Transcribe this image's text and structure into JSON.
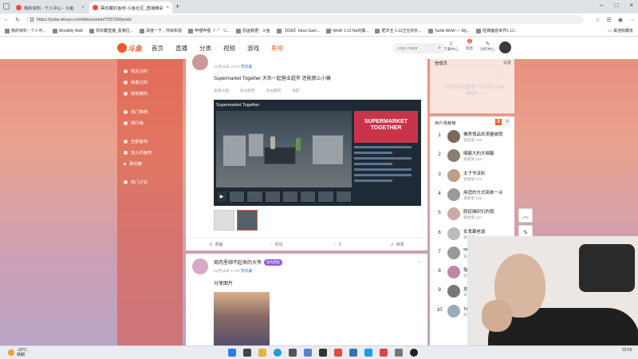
{
  "browser": {
    "tabs": [
      {
        "label": "我的资料 - 个人中心 - 斗鱼",
        "active": false
      },
      {
        "label": "票欢藏的鱼吧-斗鱼社区_直播精彩",
        "active": true
      }
    ],
    "new_tab": "+",
    "url": "https://yuba.douyu.com/discussion/735793/posts",
    "bookmarks": [
      "我的资料 - 个人中...",
      "Wootility Web",
      "票欢藏直播_看泰拉...",
      "百度一下，你就知道",
      "哔哩哔哩（'- '゜つ...",
      "原画数据 - 斗鱼",
      "【IGN】Xbox Gam...",
      "WoW 1.12 Ne的爆...",
      "肥羊全 1.12正在的扑...",
      "Turtle WoW — My...",
      "经典魔兽世界1.12..."
    ],
    "bookmarks_folder": "其他收藏夹"
  },
  "site": {
    "logo_text": "斗鱼",
    "nav": [
      "首页",
      "直播",
      "分类",
      "视频",
      "游戏",
      "鱼吧"
    ],
    "nav_active_index": 5,
    "search_placeholder": "cogo major",
    "header_icons": [
      {
        "label": "下载中心",
        "icon": "download-icon"
      },
      {
        "label": "消息",
        "icon": "bell-icon",
        "badge": "8"
      },
      {
        "label": "创作中心",
        "icon": "create-icon"
      }
    ]
  },
  "left_nav": {
    "group1": [
      "我关注的",
      "我看过的",
      "我收藏的"
    ],
    "group2": [
      "热门推荐",
      "排行榜"
    ],
    "group3": [
      "全部鱼吧",
      "加入的鱼吧",
      "票欢藏"
    ],
    "group4": [
      "热门讨论"
    ]
  },
  "post1": {
    "meta_time": "01月18日 22:47",
    "meta_source": "票欢藏",
    "title": "Supermarket Together  大伙一起营业超市 还能那么小偏",
    "mini_actions": [
      "查看大图",
      "向左旋转",
      "向右旋转",
      "收起"
    ],
    "video_title": "Supermarket Together",
    "game_cover_title": "SUPERMARKET TOGETHER",
    "footer": {
      "share": "票临",
      "comment": "评论",
      "like_count": "2",
      "forward": "转发"
    }
  },
  "post2": {
    "author": "商肉里绑不起来的大爷",
    "fan_badge": "鱼丸粉丝",
    "meta_time": "01月18日 17:03",
    "meta_source": "票欢藏",
    "text": "分享图片"
  },
  "manager_panel": {
    "title": "管理员",
    "settings": "设置",
    "slogan": "平时没时间管理？可以找小伙伴来帮忙～"
  },
  "contrib_panel": {
    "title": "用户贡献榜",
    "tabs": [
      "周",
      "月"
    ],
    "rows": [
      {
        "rank": "1",
        "name": "佛房俏品欢滴量被窝",
        "sub": "贡献值 332"
      },
      {
        "rank": "2",
        "name": "咽霸大的大咽霸",
        "sub": "贡献值 226"
      },
      {
        "rank": "3",
        "name": "太子爷泽彩",
        "sub": "贡献值 213"
      },
      {
        "rank": "4",
        "name": "用适的方式简单一点",
        "sub": "贡献值 138"
      },
      {
        "rank": "5",
        "name": "股疫厢织衍的我",
        "sub": "贡献值 110"
      },
      {
        "rank": "6",
        "name": "女鬼霸老鼠",
        "sub": "贡献值 110"
      },
      {
        "rank": "7",
        "name": "sss2763",
        "sub": "贡献值 110"
      },
      {
        "rank": "8",
        "name": "兔子nice",
        "sub": "贡献值 110"
      },
      {
        "rank": "9",
        "name": "支持张",
        "sub": "贡献值 110"
      },
      {
        "rank": "10",
        "name": "Twice一",
        "sub": "贡献值 110"
      }
    ]
  },
  "float_buttons": [
    "返回顶部",
    "发帖"
  ],
  "taskbar": {
    "temp": "-18°C",
    "weather": "晴朗",
    "clock": "23:59"
  }
}
